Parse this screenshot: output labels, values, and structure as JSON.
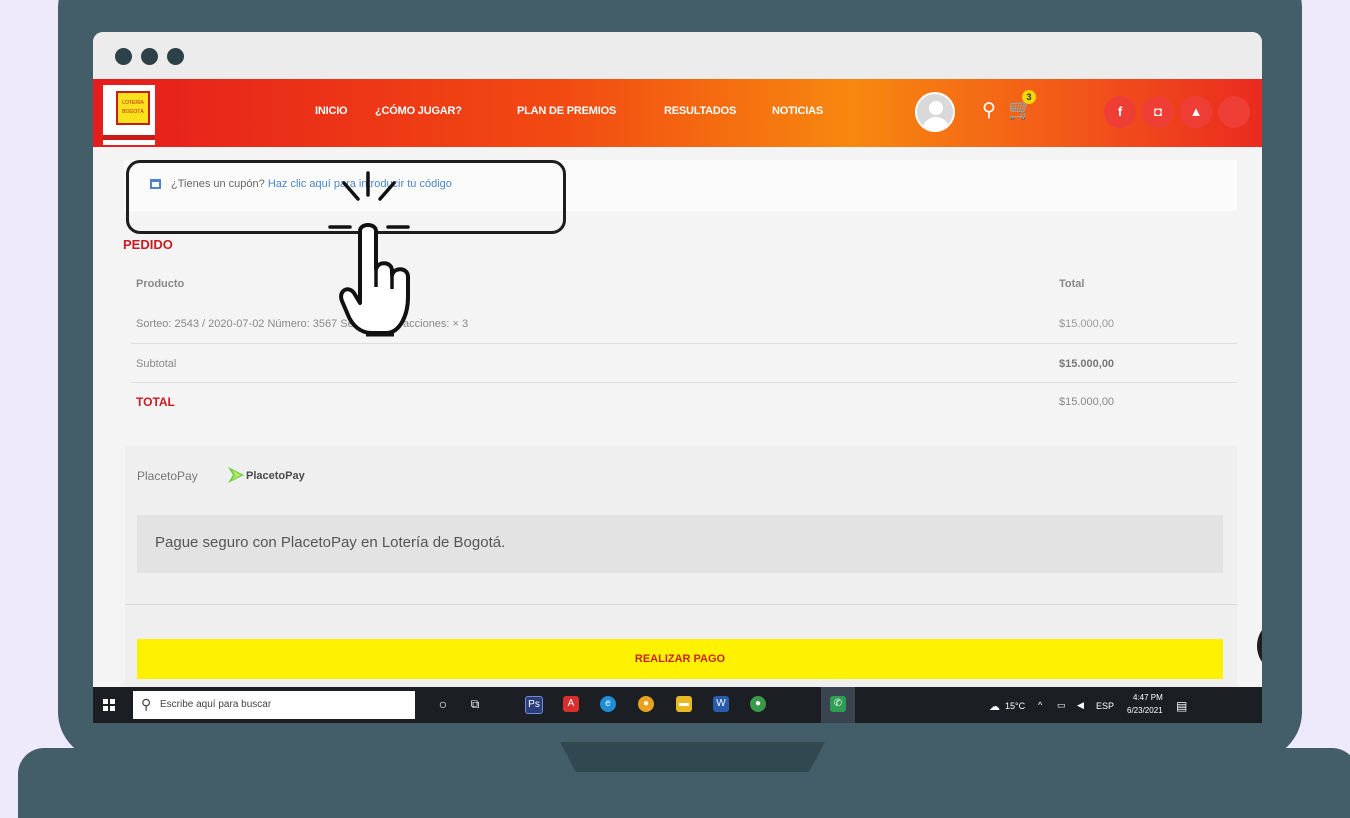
{
  "header": {
    "nav": [
      "INICIO",
      "¿CÓMO JUGAR?",
      "PLAN DE PREMIOS",
      "RESULTADOS",
      "NOTICIAS"
    ],
    "cart_count": "3",
    "social": [
      "f",
      "◘",
      "▲"
    ]
  },
  "coupon": {
    "prefix": "¿Tienes un cupón?",
    "link": "Haz clic aquí para introducir tu código"
  },
  "order": {
    "title": "PEDIDO",
    "col_product": "Producto",
    "col_total": "Total",
    "item_desc": "Sorteo: 2543 / 2020-07-02 Número: 3567 Serie: 112 Fracciones: × 3",
    "item_total": "$15.000,00",
    "subtotal_label": "Subtotal",
    "subtotal_value": "$15.000,00",
    "total_label": "TOTAL",
    "total_value": "$15.000,00"
  },
  "payment": {
    "method_label": "PlacetoPay",
    "logo_text": "PlacetoPay",
    "description": "Pague seguro con PlacetoPay en Lotería de Bogotá.",
    "button": "REALIZAR PAGO"
  },
  "taskbar": {
    "search_placeholder": "Escribe aquí para buscar",
    "temp": "15°C",
    "lang": "ESP",
    "time": "4:47 PM",
    "date": "6/23/2021"
  },
  "colors": {
    "brand_red": "#c61d23",
    "pay_button": "#fff200",
    "frame": "#435e68"
  }
}
